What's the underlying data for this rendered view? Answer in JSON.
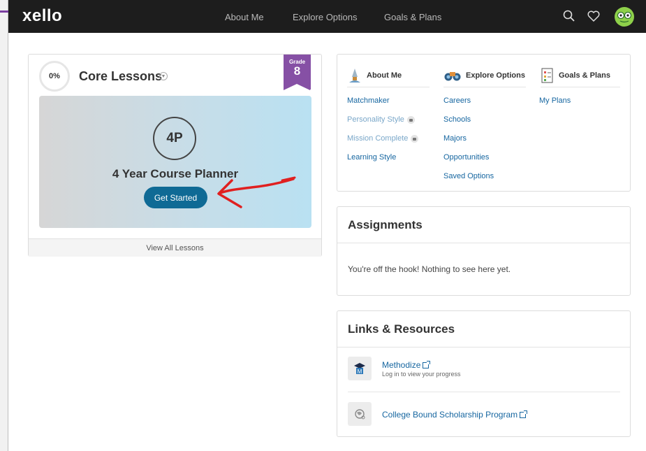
{
  "nav": {
    "logo": "xello",
    "links": [
      "About Me",
      "Explore Options",
      "Goals & Plans"
    ],
    "icons": [
      "search-icon",
      "heart-icon",
      "avatar"
    ]
  },
  "core": {
    "percent": "0%",
    "title": "Core Lessons",
    "grade_label": "Grade",
    "grade": "8",
    "lesson_badge": "4P",
    "lesson_title": "4 Year Course Planner",
    "cta": "Get Started",
    "view_all": "View All Lessons"
  },
  "explore": {
    "about": {
      "title": "About Me",
      "items": [
        "Matchmaker",
        "Personality Style",
        "Mission Complete",
        "Learning Style"
      ]
    },
    "options": {
      "title": "Explore Options",
      "items": [
        "Careers",
        "Schools",
        "Majors",
        "Opportunities",
        "Saved Options"
      ]
    },
    "goals": {
      "title": "Goals & Plans",
      "items": [
        "My Plans"
      ]
    }
  },
  "assignments": {
    "title": "Assignments",
    "message": "You're off the hook! Nothing to see here yet."
  },
  "resources": {
    "title": "Links & Resources",
    "items": [
      {
        "name": "Methodize",
        "sub": "Log in to view your progress"
      },
      {
        "name": "College Bound Scholarship Program",
        "sub": ""
      }
    ]
  },
  "colors": {
    "accent": "#8650a5",
    "button": "#0f6a95",
    "link": "#1666a0",
    "annotation": "#e02020"
  }
}
